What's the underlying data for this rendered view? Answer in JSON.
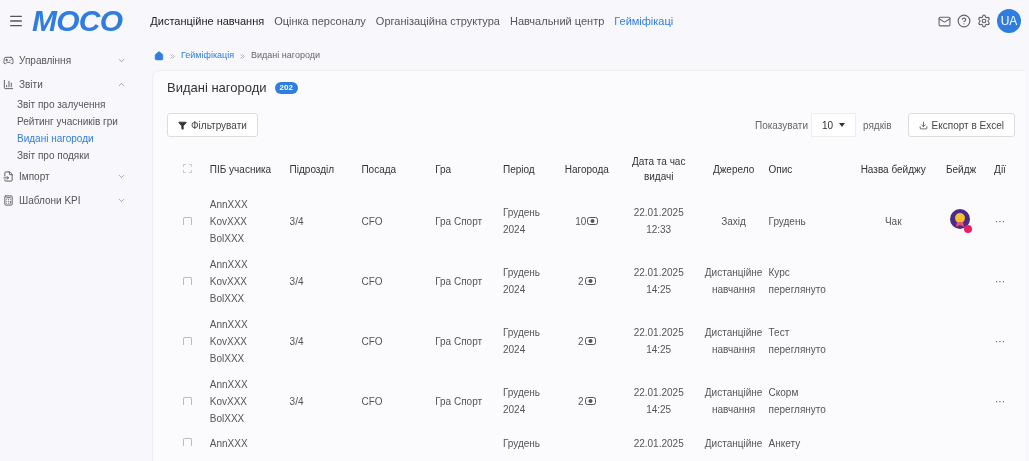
{
  "header": {
    "logo": "MOCO",
    "nav": [
      {
        "label": "Дистанційне навчання",
        "selected": false
      },
      {
        "label": "Оцінка персоналу",
        "selected": false
      },
      {
        "label": "Організаційна структура",
        "selected": false
      },
      {
        "label": "Навчальний центр",
        "selected": false
      },
      {
        "label": "Гейміфікаці",
        "selected": true
      }
    ],
    "avatar": "UA"
  },
  "sidebar": {
    "items": [
      {
        "label": "Управління",
        "expanded": false
      },
      {
        "label": "Звіти",
        "expanded": true,
        "children": [
          {
            "label": "Звіт про залучення",
            "selected": false
          },
          {
            "label": "Рейтинг учасників гри",
            "selected": false
          },
          {
            "label": "Видані нагороди",
            "selected": true
          },
          {
            "label": "Звіт про подяки",
            "selected": false
          }
        ]
      },
      {
        "label": "Імпорт",
        "expanded": false
      },
      {
        "label": "Шаблони KPI",
        "expanded": false
      }
    ]
  },
  "breadcrumb": [
    "Гейміфікація",
    "Видані нагороди"
  ],
  "page": {
    "title": "Видані нагороди",
    "count": "202",
    "filter_button": "Фільтрувати",
    "show_label": "Показувати",
    "page_size": "10",
    "rows_label": "рядків",
    "export_button": "Експорт в Excel"
  },
  "table": {
    "header_checked": false,
    "columns": [
      "ПІБ учасника",
      "Підрозділ",
      "Посада",
      "Гра",
      "Період",
      "Нагорода",
      "Дата та час видачі",
      "Джерело",
      "Опис",
      "Назва бейджу",
      "Бейдж",
      "Дії"
    ],
    "rows": [
      {
        "checked": false,
        "name": "AnnXXX KovXXX BolXXX",
        "unit": "3/4",
        "position": "CFO",
        "game": "Гра Спорт",
        "period": "Грудень 2024",
        "reward": "10",
        "date": "22.01.2025 12:33",
        "source": "Захід",
        "description": "Грудень",
        "badge_name": "Чак",
        "badge": true,
        "actions": "···"
      },
      {
        "checked": false,
        "name": "AnnXXX KovXXX BolXXX",
        "unit": "3/4",
        "position": "CFO",
        "game": "Гра Спорт",
        "period": "Грудень 2024",
        "reward": "2",
        "date": "22.01.2025 14:25",
        "source": "Дистанційне навчання",
        "description": "Курс переглянуто",
        "badge_name": "",
        "badge": false,
        "actions": "···"
      },
      {
        "checked": false,
        "name": "AnnXXX KovXXX BolXXX",
        "unit": "3/4",
        "position": "CFO",
        "game": "Гра Спорт",
        "period": "Грудень 2024",
        "reward": "2",
        "date": "22.01.2025 14:25",
        "source": "Дистанційне навчання",
        "description": "Тест переглянуто",
        "badge_name": "",
        "badge": false,
        "actions": "···"
      },
      {
        "checked": false,
        "name": "AnnXXX KovXXX BolXXX",
        "unit": "3/4",
        "position": "CFO",
        "game": "Гра Спорт",
        "period": "Грудень 2024",
        "reward": "2",
        "date": "22.01.2025 14:25",
        "source": "Дистанційне навчання",
        "description": "Скорм переглянуто",
        "badge_name": "",
        "badge": false,
        "actions": "···"
      },
      {
        "checked": false,
        "name": "AnnXXX",
        "unit": "",
        "position": "",
        "game": "",
        "period": "Грудень",
        "reward": "",
        "date": "22.01.2025",
        "source": "Дистанційне",
        "description": "Анкету",
        "badge_name": "",
        "badge": false,
        "actions": ""
      }
    ]
  }
}
